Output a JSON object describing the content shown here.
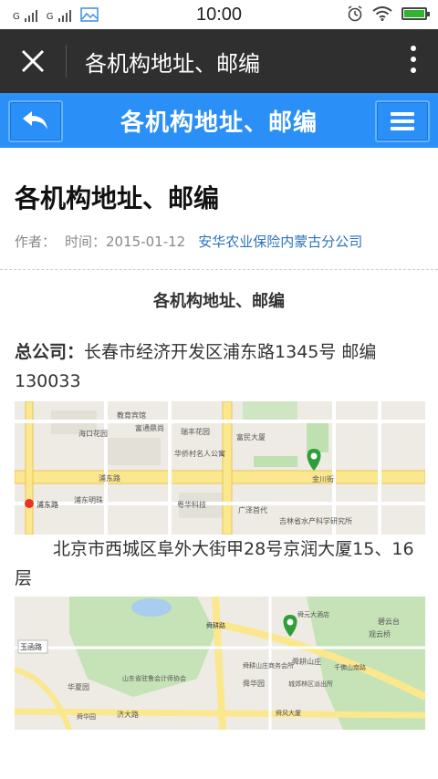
{
  "status_bar": {
    "sim1": "G",
    "sim2": "G",
    "time": "10:00"
  },
  "title_bar": {
    "title": "各机构地址、邮编"
  },
  "blue_nav": {
    "title": "各机构地址、邮编"
  },
  "article": {
    "title": "各机构地址、邮编",
    "meta_author": "作者：",
    "meta_time": "时间：2015-01-12",
    "meta_source": "安华农业保险内蒙古分公司",
    "subheading": "各机构地址、邮编",
    "hq_label": "总公司：",
    "hq_text": "长春市经济开发区浦东路1345号  邮编130033",
    "beijing_text": "北京市西城区阜外大街甲28号京润大厦15、16层"
  },
  "map1": {
    "labels": {
      "l1": "教育宾馆",
      "l2": "海口花园",
      "l3": "富通鼎尚",
      "l4": "瑞丰花园",
      "l5": "富民大厦",
      "l6": "华侨村名人公寓",
      "l7": "浦东路",
      "l8": "浦东明珠",
      "l9": "粤华科技",
      "l10": "广泽首代",
      "l11": "吉林省水产科学研究所",
      "l12": "浦东路",
      "l13": "金川街"
    }
  },
  "map2": {
    "labels": {
      "l1": "玉函路",
      "l2": "华夏园",
      "l3": "山东省驻鲁会计师协会",
      "l4": "舜华园",
      "l5": "济大路",
      "l6": "舜耕山庄商务会所",
      "l7": "舜耕山庄",
      "l8": "舜华园",
      "l9": "城郊林区派出所",
      "l10": "千佛山南路",
      "l11": "舜元大酒店",
      "l12": "舜耕路",
      "l13": "碧云台",
      "l14": "观云桥",
      "l15": "舜风大厦"
    }
  }
}
